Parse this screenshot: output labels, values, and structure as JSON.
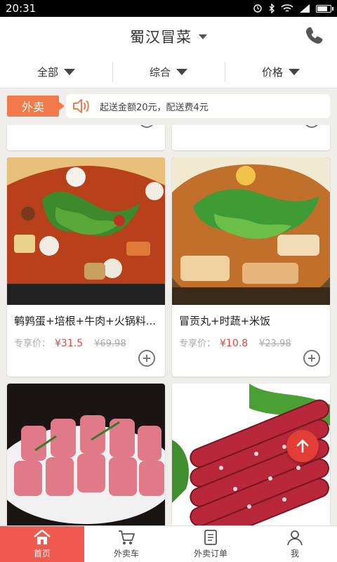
{
  "status_bar": {
    "time": "20:31"
  },
  "header": {
    "title": "蜀汉冒菜"
  },
  "filters": [
    {
      "label": "全部"
    },
    {
      "label": "综合"
    },
    {
      "label": "价格"
    }
  ],
  "notice": {
    "tag": "外卖",
    "text": "起送金额20元，配送费4元"
  },
  "products": [
    {
      "name": "",
      "price_label": "",
      "price": "",
      "original_price": ""
    },
    {
      "name": "",
      "price_label": "",
      "price": "",
      "original_price": ""
    },
    {
      "name": "鹌鹑蛋+培根+牛肉+火锅料...",
      "price_label": "专享价：",
      "price": "¥31.5",
      "original_price": "¥69.98"
    },
    {
      "name": "冒贡丸+时蔬+米饭",
      "price_label": "专享价：",
      "price": "¥10.8",
      "original_price": "¥23.98"
    }
  ],
  "tabbar": [
    {
      "label": "首页",
      "icon": "home-icon",
      "active": true
    },
    {
      "label": "外卖车",
      "icon": "cart-icon"
    },
    {
      "label": "外卖订单",
      "icon": "order-icon"
    },
    {
      "label": "我",
      "icon": "user-icon"
    }
  ],
  "colors": {
    "accent": "#f05a50",
    "price": "#e2453b",
    "tag": "#f27a4a"
  }
}
